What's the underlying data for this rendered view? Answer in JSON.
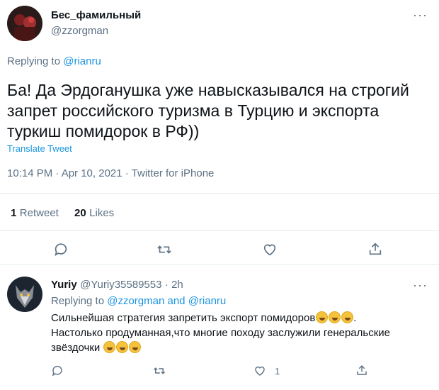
{
  "tweet": {
    "author_name": "Бес_фамильный",
    "author_handle": "@zzorgman",
    "replying_prefix": "Replying to",
    "replying_to": "@rianru",
    "text": "Ба! Да Эрдоганушка уже навысказывался на строгий запрет российского туризма в Турцию и экспорта туркиш помидорок в РФ))",
    "translate_label": "Translate Tweet",
    "timestamp": "10:14 PM · Apr 10, 2021 · Twitter for iPhone",
    "stats": {
      "retweets_count": "1",
      "retweets_label": "Retweet",
      "likes_count": "20",
      "likes_label": "Likes"
    },
    "actions": [
      "reply-icon",
      "retweet-icon",
      "like-icon",
      "share-icon"
    ]
  },
  "reply": {
    "author_name": "Yuriy",
    "author_handle": "@Yuriy35589553",
    "time": "· 2h",
    "replying_prefix": "Replying to",
    "replying_to_1": "@zzorgman",
    "replying_and": "and",
    "replying_to_2": "@rianru",
    "text_line1": "Сильнейшая стратегия запретить экспорт помидоров",
    "text_line1_end": ".",
    "text_line2": "Настолько продуманная,что многие походу заслужили генеральские",
    "text_line3": "звёздочки",
    "emoji_name": "rolling-on-floor-laughing-emoji",
    "like_count": "1"
  },
  "colors": {
    "accent": "#1b95e0",
    "secondary_text": "#5b7083",
    "divider": "#e6ecf0"
  }
}
